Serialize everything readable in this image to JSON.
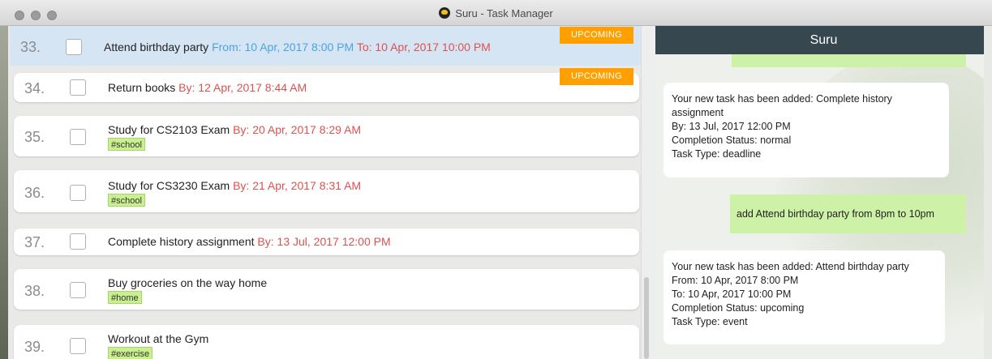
{
  "window": {
    "title": "Suru - Task Manager"
  },
  "tasks": [
    {
      "number": "33.",
      "name": "Attend birthday party",
      "from": "From: 10 Apr, 2017 8:00 PM",
      "to": "To: 10 Apr, 2017 10:00 PM",
      "badge": "UPCOMING",
      "selected": true
    },
    {
      "number": "34.",
      "name": "Return books",
      "by": "By: 12 Apr, 2017 8:44 AM",
      "badge": "UPCOMING"
    },
    {
      "number": "35.",
      "name": "Study for CS2103 Exam",
      "by": "By: 20 Apr, 2017 8:29 AM",
      "tag": "#school"
    },
    {
      "number": "36.",
      "name": "Study for CS3230 Exam",
      "by": "By: 21 Apr, 2017 8:31 AM",
      "tag": "#school"
    },
    {
      "number": "37.",
      "name": "Complete history assignment",
      "by": "By: 13 Jul, 2017 12:00 PM"
    },
    {
      "number": "38.",
      "name": "Buy groceries on the way home",
      "tag": "#home"
    },
    {
      "number": "39.",
      "name": "Workout at the Gym",
      "tag": "#exercise"
    }
  ],
  "chat": {
    "header": "Suru",
    "messages": [
      {
        "from": "bot",
        "lines": [
          "Your new task has been added: Complete history",
          "assignment",
          "By: 13 Jul, 2017 12:00 PM",
          "Completion Status: normal",
          "Task Type: deadline"
        ]
      },
      {
        "from": "user",
        "text": "add Attend birthday party from 8pm to 10pm"
      },
      {
        "from": "bot",
        "lines": [
          "Your new task has been added: Attend birthday party",
          "From: 10 Apr, 2017 8:00 PM",
          "To: 10 Apr, 2017 10:00 PM",
          "Completion Status: upcoming",
          "Task Type: event"
        ]
      }
    ]
  },
  "colors": {
    "accent_badge": "#ff9f00",
    "tag_bg": "#c9ef8e",
    "date_red": "#d9534f",
    "date_blue": "#4aa3df",
    "chat_header": "#37474f",
    "user_bubble": "#cdf1a6"
  }
}
